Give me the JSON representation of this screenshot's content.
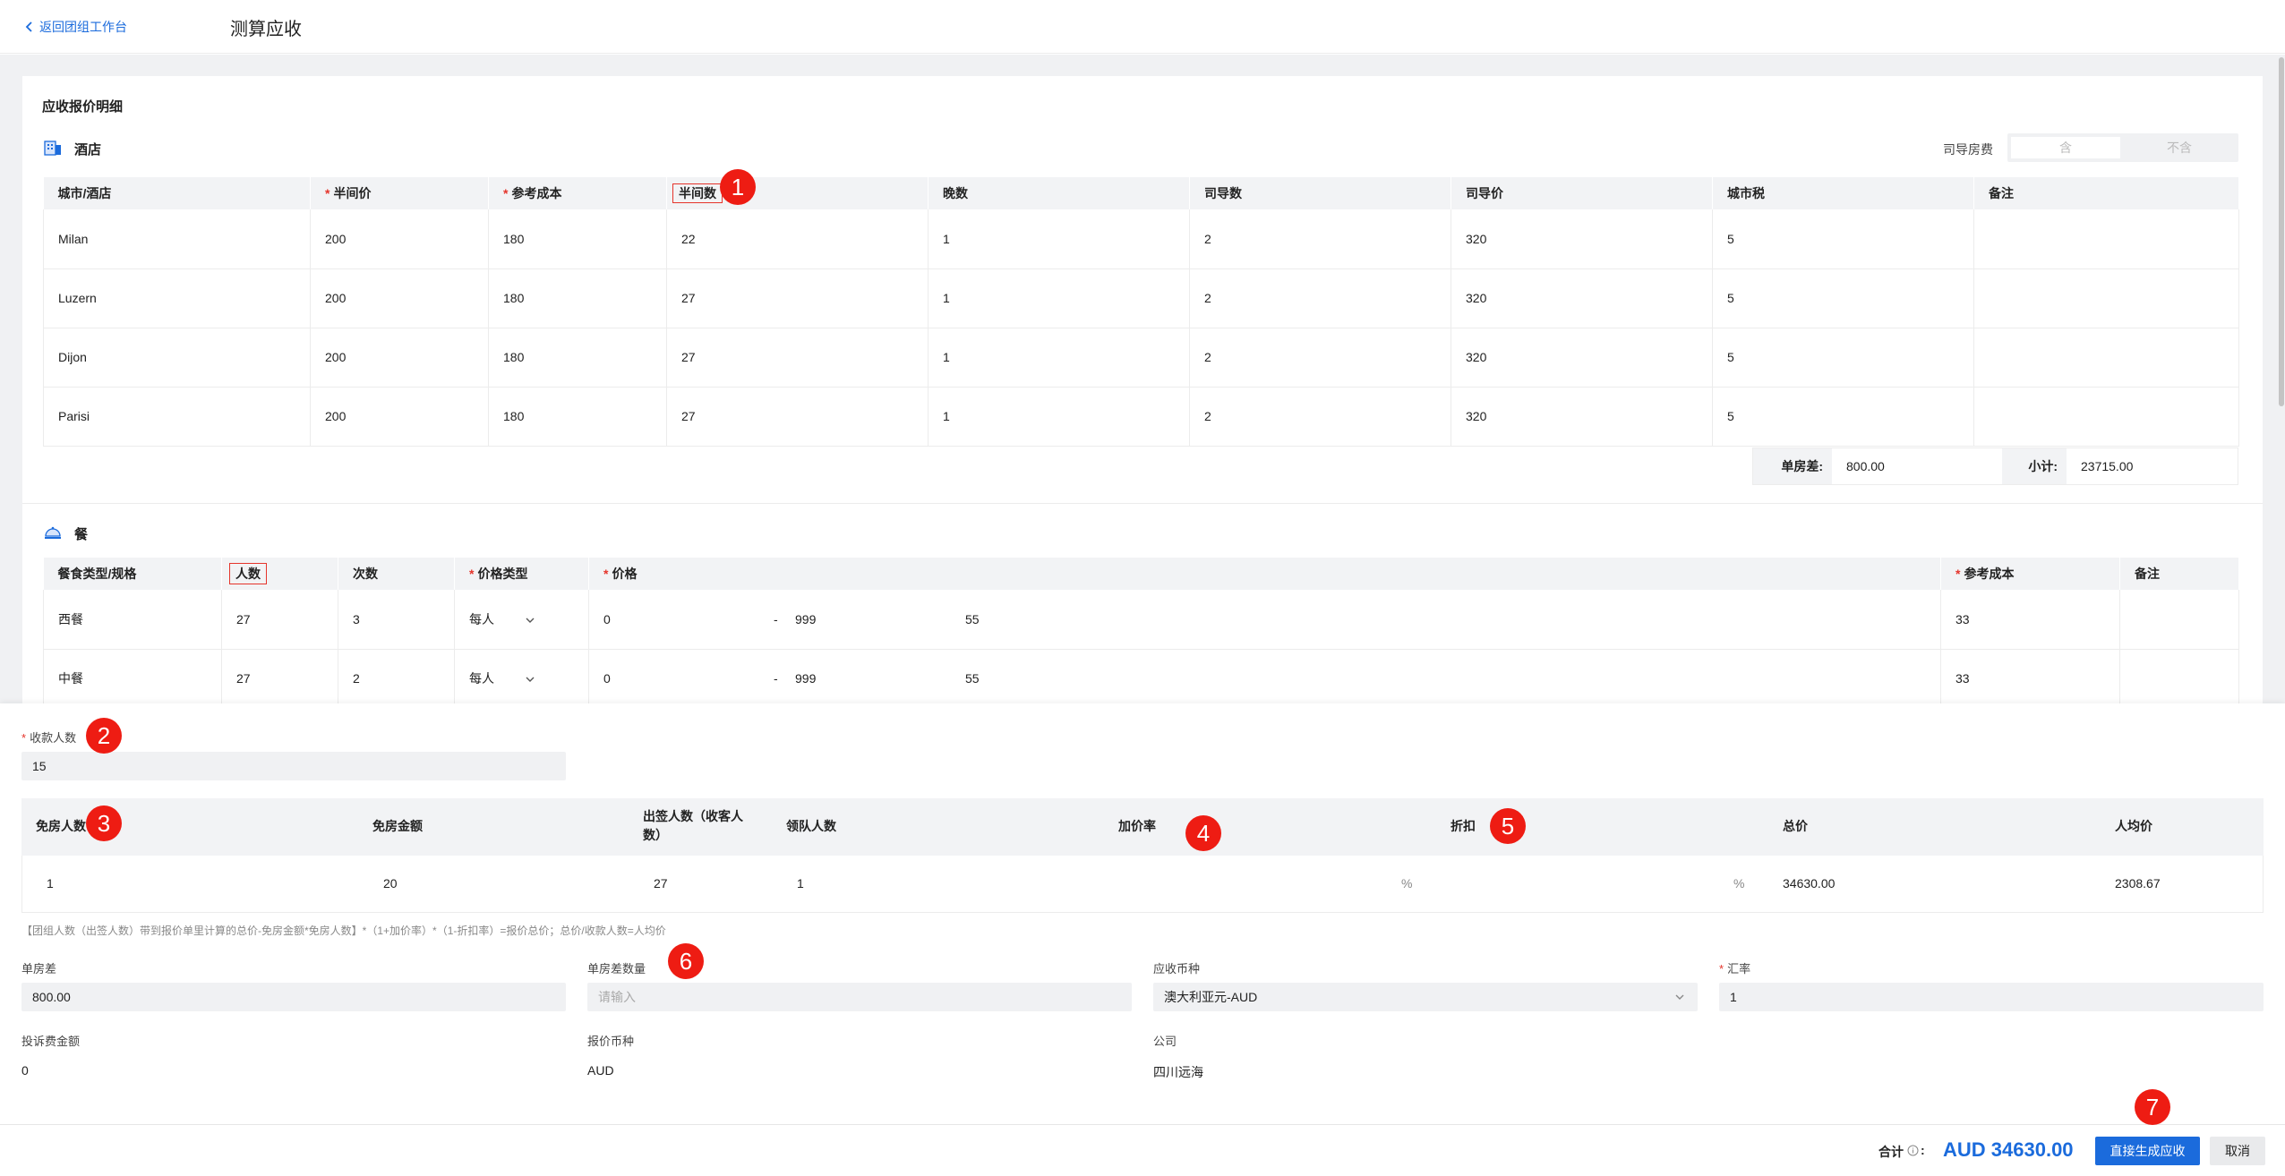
{
  "header": {
    "back_label": "返回团组工作台",
    "title": "测算应收"
  },
  "detail_title": "应收报价明细",
  "hotel": {
    "title": "酒店",
    "guide_fee_label": "司导房费",
    "toggle_on": "含",
    "toggle_off": "不含",
    "columns": [
      "城市/酒店",
      "半间价",
      "参考成本",
      "半间数",
      "晚数",
      "司导数",
      "司导价",
      "城市税",
      "备注"
    ],
    "rows": [
      [
        "Milan",
        "200",
        "180",
        "22",
        "1",
        "2",
        "320",
        "5",
        ""
      ],
      [
        "Luzern",
        "200",
        "180",
        "27",
        "1",
        "2",
        "320",
        "5",
        ""
      ],
      [
        "Dijon",
        "200",
        "180",
        "27",
        "1",
        "2",
        "320",
        "5",
        ""
      ],
      [
        "Parisi",
        "200",
        "180",
        "27",
        "1",
        "2",
        "320",
        "5",
        ""
      ]
    ],
    "single_room_diff_label": "单房差:",
    "single_room_diff_value": "800.00",
    "subtotal_label": "小计:",
    "subtotal_value": "23715.00"
  },
  "meal": {
    "title": "餐",
    "columns": [
      "餐食类型/规格",
      "人数",
      "次数",
      "价格类型",
      "价格",
      "参考成本",
      "备注"
    ],
    "rows": [
      {
        "type": "西餐",
        "people": "27",
        "times": "3",
        "price_type": "每人",
        "min": "0",
        "dash": "-",
        "max": "999",
        "price": "55",
        "cost": "33",
        "note": ""
      },
      {
        "type": "中餐",
        "people": "27",
        "times": "2",
        "price_type": "每人",
        "min": "0",
        "dash": "-",
        "max": "999",
        "price": "55",
        "cost": "33",
        "note": ""
      }
    ]
  },
  "collect": {
    "label": "收款人数",
    "value": "15"
  },
  "summary": {
    "columns": [
      "免房人数",
      "免房金额",
      "出签人数（收客人数）",
      "领队人数",
      "加价率",
      "折扣",
      "总价",
      "人均价"
    ],
    "row": {
      "free_rooms": "1",
      "free_amount": "20",
      "visa_count": "27",
      "leaders": "1",
      "markup_unit": "%",
      "discount_unit": "%",
      "total": "34630.00",
      "avg": "2308.67"
    }
  },
  "formula": "【团组人数（出签人数）带到报价单里计算的总价-免房金额*免房人数】*（1+加价率）*（1-折扣率）=报价总价；总价/收款人数=人均价",
  "form": {
    "single_diff_label": "单房差",
    "single_diff_value": "800.00",
    "single_diff_qty_label": "单房差数量",
    "single_diff_qty_placeholder": "请输入",
    "currency_label": "应收币种",
    "currency_value": "澳大利亚元-AUD",
    "rate_label": "汇率",
    "rate_value": "1",
    "complaint_label": "投诉费金额",
    "complaint_value": "0",
    "quote_currency_label": "报价币种",
    "quote_currency_value": "AUD",
    "company_label": "公司",
    "company_value": "四川远海"
  },
  "footer": {
    "total_label": "合计",
    "total_value": "AUD 34630.00",
    "generate_label": "直接生成应收",
    "cancel_label": "取消"
  },
  "badges": [
    "1",
    "2",
    "3",
    "4",
    "5",
    "6",
    "7"
  ],
  "colors": {
    "primary": "#1b6bdc",
    "required": "#e5342b",
    "badge": "#ee1c13"
  }
}
